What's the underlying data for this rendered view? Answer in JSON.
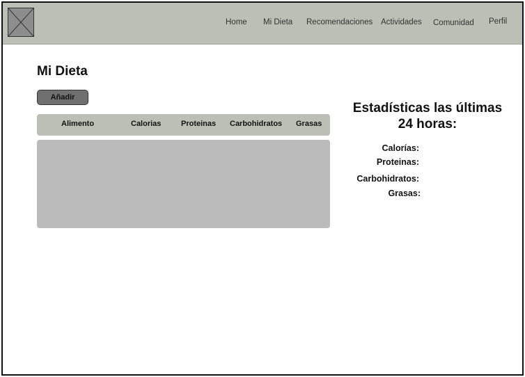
{
  "nav": {
    "items": [
      "Home",
      "Mi Dieta",
      "Recomendaciones",
      "Actividades",
      "Comunidad",
      "Perfil"
    ]
  },
  "page": {
    "title": "Mi Dieta",
    "add_button": "Añadir"
  },
  "table": {
    "columns": [
      "Alimento",
      "Calorias",
      "Proteinas",
      "Carbohidratos",
      "Grasas"
    ],
    "rows": []
  },
  "stats": {
    "title": "Estadísticas las últimas 24 horas:",
    "labels": [
      "Calorías:",
      "Proteinas:",
      "Carbohidratos:",
      "Grasas:"
    ]
  },
  "colors": {
    "header_bg": "#bcbfb5",
    "table_body_bg": "#bbbbbb",
    "button_bg": "#707070",
    "logo_placeholder": "#8d8d8d"
  },
  "icons": {
    "logo": "image-placeholder-icon"
  }
}
